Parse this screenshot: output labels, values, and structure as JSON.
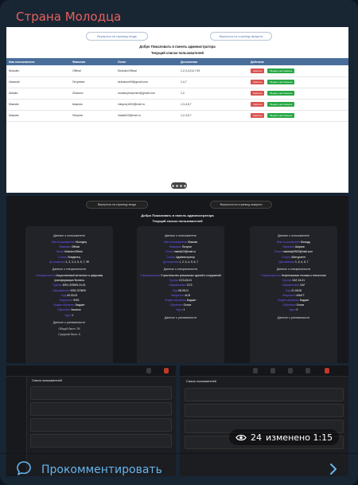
{
  "channel": {
    "title": "Страна Молодца"
  },
  "shot1": {
    "back_buttons": [
      "Вернуться на страницу входа",
      "Вернуться на страницу аккаунта"
    ],
    "welcome": "Добро Пожаловать в панель администратора",
    "list_title": "Текущий список пользователей",
    "columns": [
      "Имя пользователя",
      "Фамилия",
      "Логин",
      "Достижения",
      "Действия"
    ],
    "rows": [
      [
        "Molodec",
        "Official",
        "MolodecOfficial",
        "1,2,3,4,5,6,7,99"
      ],
      [
        "Hаsanali",
        "Петревич",
        "kirlmasos99@gmail.com",
        "1,4,7"
      ],
      [
        "Aldiaks",
        "Zhdanov",
        "russianyesepmen@gmail.com",
        "1,2"
      ],
      [
        "Максим",
        "Шарков",
        "nikopxq1603@mail.ru",
        "1,3,4,5,7"
      ],
      [
        "Максим",
        "Пичугин",
        "maksik20@mail.ru",
        "1,2,4,5,7"
      ]
    ],
    "delete_label": "Удалить",
    "add_label": "Выдать достижение"
  },
  "shot2": {
    "back_buttons": [
      "Вернуться на страницу входа",
      "Вернуться на страницу аккаунта"
    ],
    "welcome": "Добро Пожаловать в панель администратора",
    "list_title": "Текущий список пользователей",
    "user_section": "Данные о пользователе",
    "spec_section": "Данные о специальности",
    "perf_section": "Данные о успеваемости",
    "cards": [
      {
        "user": [
          [
            "Имя пользователя",
            "Молодец"
          ],
          [
            "Фамилия",
            "Official"
          ],
          [
            "Логин",
            "MolodecOfficial"
          ],
          [
            "Статус",
            "Владелец"
          ],
          [
            "Достижения",
            "1, 2, 3, 4, 5, 6, 7, 99"
          ]
        ],
        "spec": [
          [
            "Специальность",
            "Искусственный интеллект и цифровая трансформация бизнеса"
          ],
          [
            "Группа",
            "БПИ, БПИ09-24-01"
          ],
          [
            "Направление",
            "БПИ, БПИ09"
          ],
          [
            "Код",
            "09.03.03"
          ],
          [
            "Факультет",
            "ФЭО"
          ],
          [
            "Форма обучения",
            "Бюджет"
          ],
          [
            "Обучение",
            "Заочное"
          ],
          [
            "Курс",
            "1"
          ]
        ],
        "perf": [
          "Общий балл: 35",
          "Средний балл: 5"
        ]
      },
      {
        "user": [
          [
            "Имя пользователя",
            "Максим"
          ],
          [
            "Фамилия",
            "Пичугин"
          ],
          [
            "Логин",
            "maksik20@mail.ru"
          ],
          [
            "Статус",
            "Администратор"
          ],
          [
            "Достижения",
            "1, 2, 3, 4, 5, 6, 7"
          ]
        ],
        "spec": [
          [
            "Специальность",
            "Строительство уникальных зданий и сооружений"
          ],
          [
            "Группа",
            "СС3-24-01"
          ],
          [
            "Направление",
            "СС3"
          ],
          [
            "Код",
            "08.05.01"
          ],
          [
            "Факультет",
            "АСИ"
          ],
          [
            "Форма обучения",
            "Бюджет"
          ],
          [
            "Обучение",
            "Очное"
          ],
          [
            "Курс",
            "1"
          ]
        ],
        "perf": []
      },
      {
        "user": [
          [
            "Имя пользователя",
            "Молодц"
          ],
          [
            "Фамилия",
            "Шарков"
          ],
          [
            "Логин",
            "makshdp9503@mail.com"
          ],
          [
            "Статус",
            "Абитуриент"
          ],
          [
            "Достижения",
            "1, 3, 4, 5, 7"
          ]
        ],
        "spec": [
          [
            "Специальность",
            "Нефтегазовые техника и технологии"
          ],
          [
            "Группа",
            "САГ-24-01"
          ],
          [
            "Направление",
            "САГ"
          ],
          [
            "Код",
            "21.05.06"
          ],
          [
            "Факультет",
            "ИНиГТ"
          ],
          [
            "Форма обучения",
            "Бюджет"
          ],
          [
            "Обучение",
            "Очное"
          ],
          [
            "Курс",
            "2"
          ]
        ],
        "perf": []
      }
    ]
  },
  "shot3": {
    "list_title": "Список пользователей"
  },
  "shot4": {
    "list_title": "Список пользователей"
  },
  "views": {
    "count": "24",
    "edited": "изменено 1:15"
  },
  "comment": {
    "label": "Прокомментировать"
  }
}
